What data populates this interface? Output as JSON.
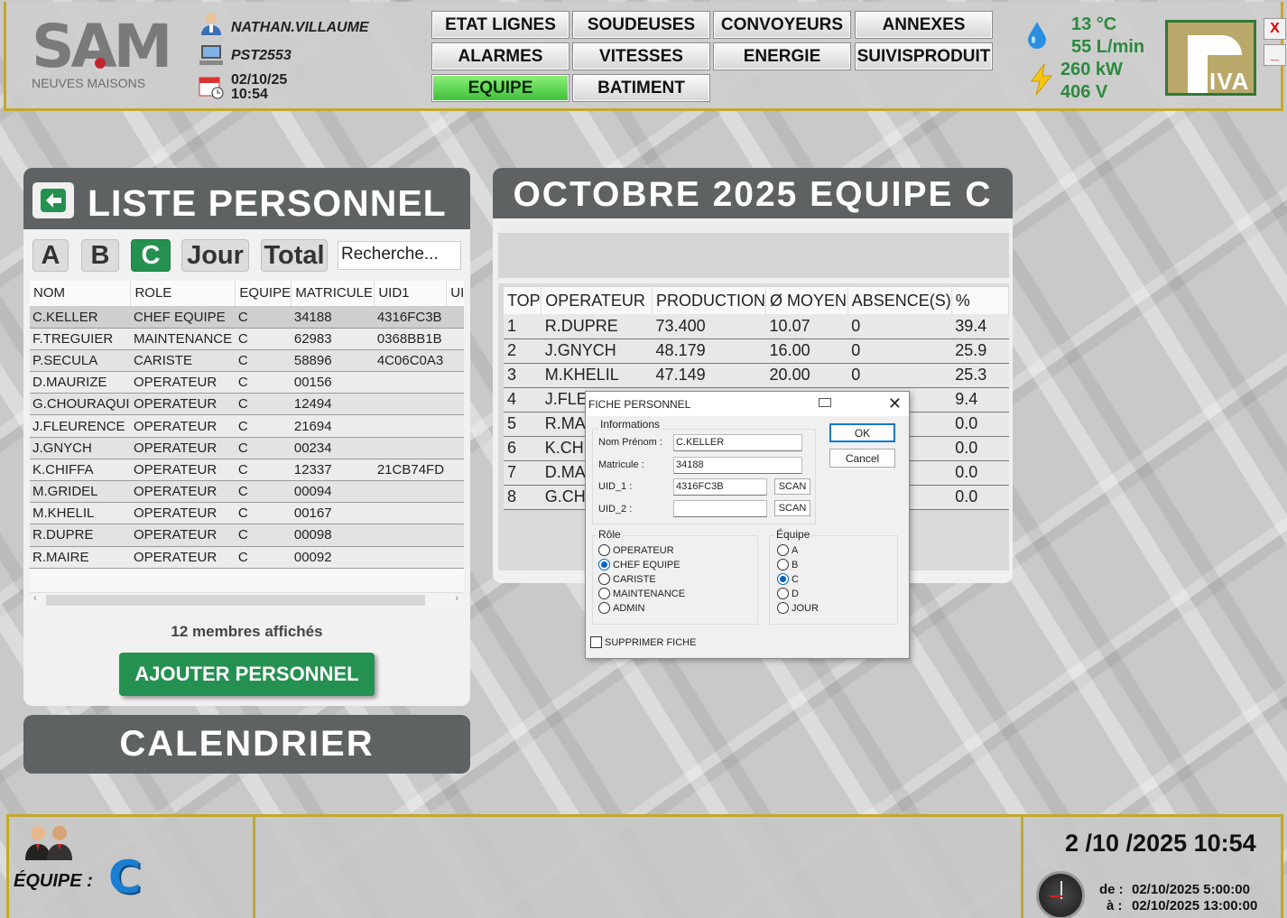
{
  "header": {
    "logo_text": "SAM",
    "logo_sub": "NEUVES MAISONS",
    "user": "NATHAN.VILLAUME",
    "station": "PST2553",
    "date": "02/10/25",
    "time": "10:54",
    "nav": [
      "ETAT LIGNES",
      "SOUDEUSES",
      "CONVOYEURS",
      "ANNEXES",
      "ALARMES",
      "VITESSES",
      "ENERGIE",
      "SUIVISPRODUIT",
      "EQUIPE",
      "BATIMENT"
    ],
    "active_nav": "EQUIPE",
    "temp": "13 °C",
    "flow": "55 L/min",
    "power": "260 kW",
    "voltage": "406 V",
    "brand": "IVA",
    "close_label": "X",
    "min_label": "_"
  },
  "left_panel": {
    "title": "LISTE PERSONNEL",
    "filters": [
      "A",
      "B",
      "C",
      "Jour",
      "Total"
    ],
    "active_filter": "C",
    "search_value": "Recherche...",
    "columns": [
      "NOM",
      "ROLE",
      "EQUIPE",
      "MATRICULE",
      "UID1",
      "UI"
    ],
    "rows": [
      [
        "C.KELLER",
        "CHEF EQUIPE",
        "C",
        "34188",
        "4316FC3B"
      ],
      [
        "F.TREGUIER",
        "MAINTENANCE",
        "C",
        "62983",
        "0368BB1B"
      ],
      [
        "P.SECULA",
        "CARISTE",
        "C",
        "58896",
        "4C06C0A3"
      ],
      [
        "D.MAURIZE",
        "OPERATEUR",
        "C",
        "00156",
        ""
      ],
      [
        "G.CHOURAQUI",
        "OPERATEUR",
        "C",
        "12494",
        ""
      ],
      [
        "J.FLEURENCE",
        "OPERATEUR",
        "C",
        "21694",
        ""
      ],
      [
        "J.GNYCH",
        "OPERATEUR",
        "C",
        "00234",
        ""
      ],
      [
        "K.CHIFFA",
        "OPERATEUR",
        "C",
        "12337",
        "21CB74FD"
      ],
      [
        "M.GRIDEL",
        "OPERATEUR",
        "C",
        "00094",
        ""
      ],
      [
        "M.KHELIL",
        "OPERATEUR",
        "C",
        "00167",
        ""
      ],
      [
        "R.DUPRE",
        "OPERATEUR",
        "C",
        "00098",
        ""
      ],
      [
        "R.MAIRE",
        "OPERATEUR",
        "C",
        "00092",
        ""
      ]
    ],
    "count_text": "12 membres affichés",
    "add_label": "AJOUTER PERSONNEL",
    "calendar_label": "CALENDRIER"
  },
  "right_panel": {
    "title": "OCTOBRE 2025 EQUIPE C",
    "columns": [
      "TOP",
      "OPERATEUR",
      "PRODUCTION",
      "Ø MOYEN",
      "ABSENCE(S)",
      "%"
    ],
    "rows": [
      [
        "1",
        "R.DUPRE",
        "73.400",
        "10.07",
        "0",
        "39.4"
      ],
      [
        "2",
        "J.GNYCH",
        "48.179",
        "16.00",
        "0",
        "25.9"
      ],
      [
        "3",
        "M.KHELIL",
        "47.149",
        "20.00",
        "0",
        "25.3"
      ],
      [
        "4",
        "J.FLEU",
        "",
        "",
        "",
        "9.4"
      ],
      [
        "5",
        "R.MA",
        "",
        "",
        "",
        "0.0"
      ],
      [
        "6",
        "K.CHI",
        "",
        "",
        "",
        "0.0"
      ],
      [
        "7",
        "D.MA",
        "",
        "",
        "",
        "0.0"
      ],
      [
        "8",
        "G.CHO",
        "",
        "",
        "",
        "0.0"
      ]
    ]
  },
  "dialog": {
    "title": "FICHE PERSONNEL",
    "info_group": "Informations",
    "nom_label": "Nom Prénom :",
    "nom_value": "C.KELLER",
    "mat_label": "Matricule :",
    "mat_value": "34188",
    "uid1_label": "UID_1 :",
    "uid1_value": "4316FC3B",
    "uid2_label": "UID_2 :",
    "uid2_value": "",
    "scan_label": "SCAN",
    "ok_label": "OK",
    "cancel_label": "Cancel",
    "role_group": "Rôle",
    "roles": [
      "OPERATEUR",
      "CHEF EQUIPE",
      "CARISTE",
      "MAINTENANCE",
      "ADMIN"
    ],
    "selected_role": "CHEF EQUIPE",
    "team_group": "Équipe",
    "teams": [
      "A",
      "B",
      "C",
      "D",
      "JOUR"
    ],
    "selected_team": "C",
    "delete_label": "SUPPRIMER FICHE"
  },
  "footer": {
    "equipe_label": "ÉQUIPE :",
    "equipe_letter": "C",
    "datetime": "2 /10 /2025  10:54",
    "from_label": "de :",
    "from_value": "02/10/2025 5:00:00",
    "to_label": "à :",
    "to_value": "02/10/2025 13:00:00"
  },
  "colors": {
    "accent_green": "#259150",
    "gold_border": "#c4a829",
    "active_nav": "#5ad64a",
    "panel_header": "#5e6263"
  }
}
